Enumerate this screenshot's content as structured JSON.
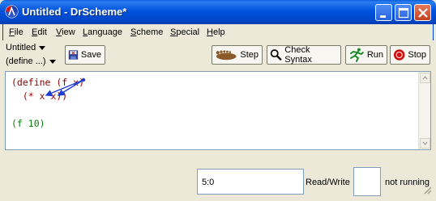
{
  "window": {
    "title": "Untitled - DrScheme*"
  },
  "menu": [
    {
      "label": "File",
      "u": "F",
      "rest": "ile"
    },
    {
      "label": "Edit",
      "u": "E",
      "rest": "dit"
    },
    {
      "label": "View",
      "u": "V",
      "rest": "iew"
    },
    {
      "label": "Language",
      "u": "L",
      "rest": "anguage"
    },
    {
      "label": "Scheme",
      "u": "S",
      "rest": "cheme"
    },
    {
      "label": "Special",
      "u": "S",
      "rest": "pecial"
    },
    {
      "label": "Help",
      "u": "H",
      "rest": "elp"
    }
  ],
  "toolbar": {
    "file_menu": "Untitled",
    "define_menu": "(define ...)",
    "save": "Save",
    "step": "Step",
    "check_syntax": "Check Syntax",
    "run": "Run",
    "stop": "Stop"
  },
  "editor": {
    "lines": [
      "(define (f x)",
      "  (* x x))",
      "",
      "(f 10)"
    ]
  },
  "status": {
    "position": "5:0",
    "mode": "Read/Write",
    "running": "not running"
  },
  "colors": {
    "title_bar": "#0054e3",
    "code": "#8b0000",
    "constant": "#0b7a0b",
    "arrow": "#1a3bd6"
  }
}
